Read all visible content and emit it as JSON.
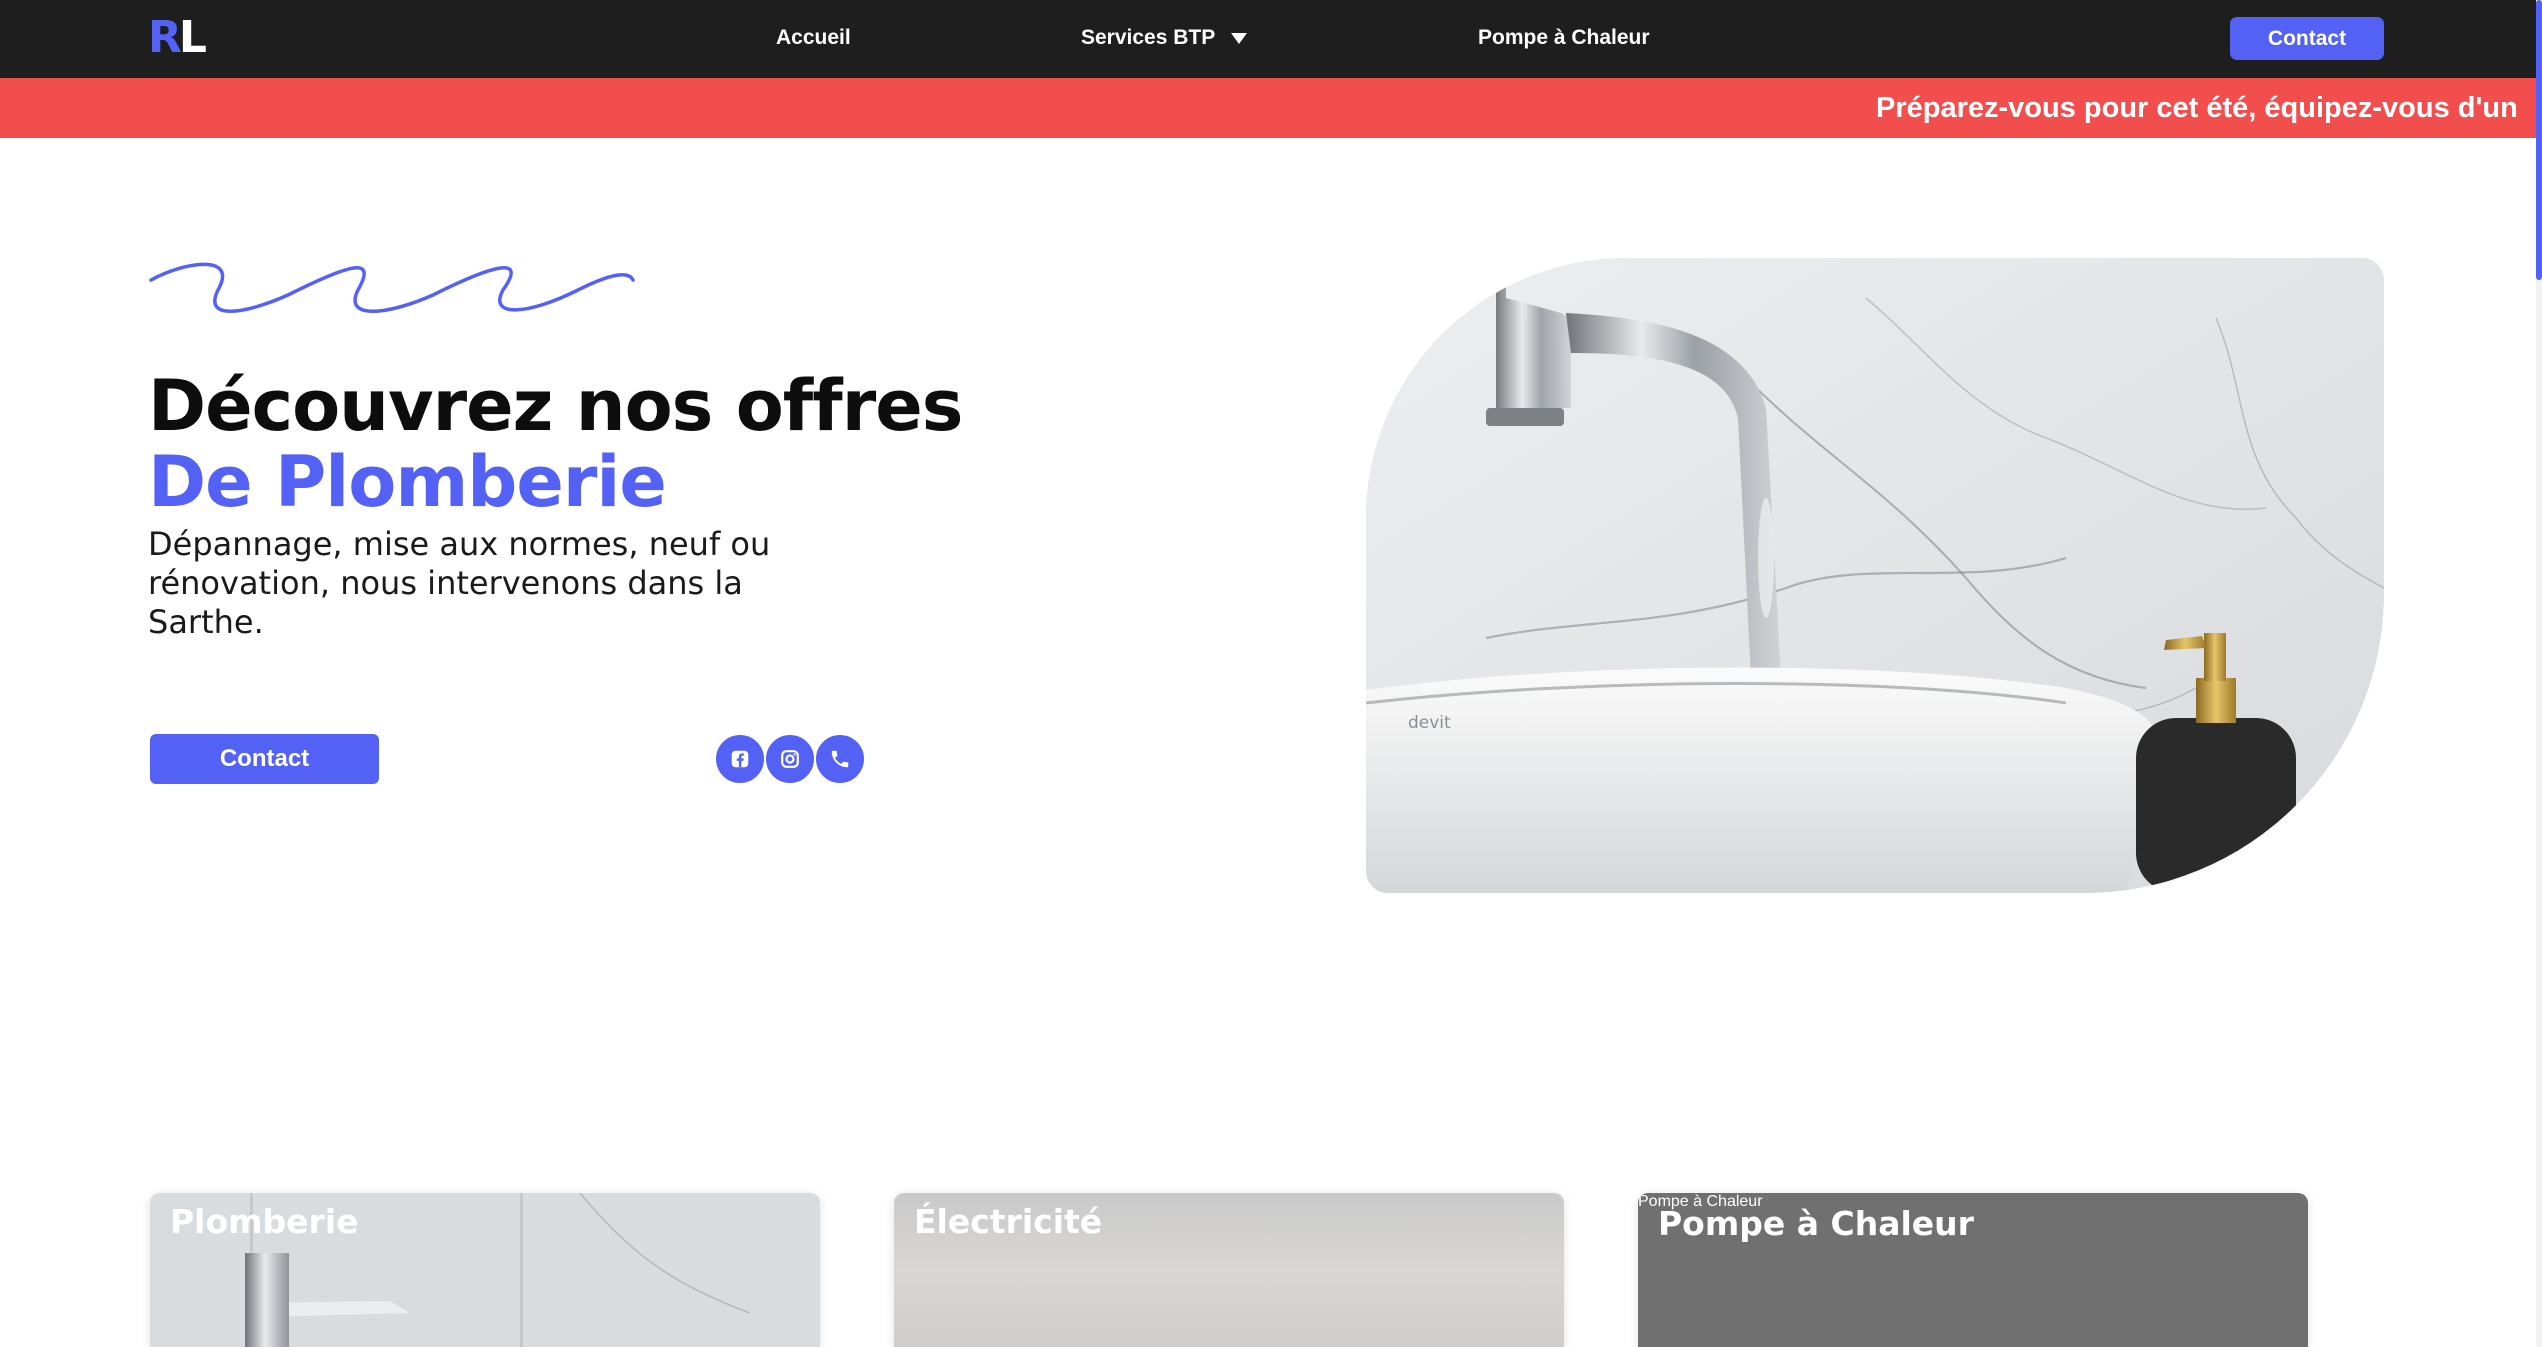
{
  "nav": {
    "logo_r": "R",
    "logo_l": "L",
    "items": [
      {
        "label": "Accueil"
      },
      {
        "label": "Services BTP"
      },
      {
        "label": "Pompe à Chaleur"
      }
    ],
    "contact_label": "Contact"
  },
  "banner": {
    "text": "Préparez-vous pour cet été, équipez-vous d'un"
  },
  "hero": {
    "title_line1": "Découvrez nos offres",
    "title_line2": "De Plomberie",
    "description": "Dépannage, mise aux normes, neuf ou rénovation, nous intervenons dans la Sarthe.",
    "contact_label": "Contact",
    "image_brand_text": "devit",
    "socials": [
      {
        "icon": "facebook-icon"
      },
      {
        "icon": "instagram-icon"
      },
      {
        "icon": "phone-icon"
      }
    ]
  },
  "cards": [
    {
      "title": "Plomberie"
    },
    {
      "title": "Électricité"
    },
    {
      "title": "Pompe à Chaleur",
      "alt_text": "Pompe à Chaleur"
    }
  ],
  "colors": {
    "accent": "#5461f5",
    "banner": "#f24e4e",
    "nav_bg": "#1e1e1e"
  }
}
